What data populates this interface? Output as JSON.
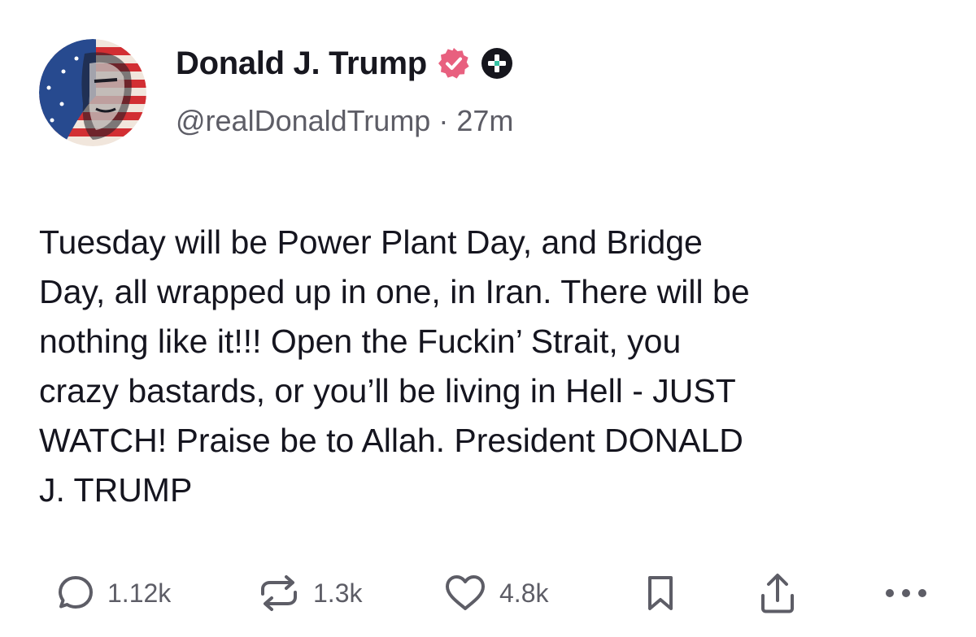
{
  "post": {
    "author": {
      "display_name": "Donald J. Trump",
      "handle": "@realDonaldTrump",
      "separator": "·",
      "time_ago": "27m",
      "verified_badge_color": "#e8607f",
      "avatar_icon": "american-flag-portrait"
    },
    "body": "Tuesday will be Power Plant Day, and Bridge\nDay, all wrapped up in one, in Iran. There will be\nnothing like it!!! Open the Fuckin’ Strait, you\ncrazy bastards, or you’ll be living in Hell - JUST\nWATCH! Praise be to Allah. President DONALD\nJ. TRUMP",
    "actions": {
      "reply_count": "1.12k",
      "repost_count": "1.3k",
      "like_count": "4.8k"
    }
  },
  "colors": {
    "text_primary": "#15151f",
    "text_secondary": "#5d5d66",
    "verified_pink": "#e8607f",
    "background": "#ffffff"
  }
}
